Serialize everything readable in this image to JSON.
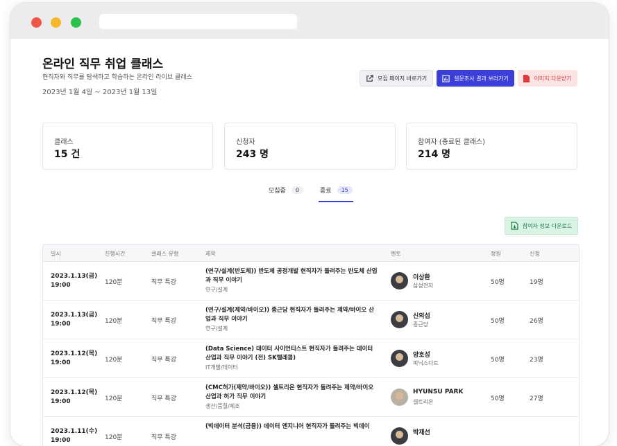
{
  "header": {
    "title": "온라인 직무 취업 클래스",
    "subtitle": "현직자와 직무를 탐색하고 학습하는 온라인 라이브 클래스",
    "dates": "2023년 1월 4일 ~ 2023년 1월 13일"
  },
  "buttons": {
    "recruit": "모집 페이지 바로가기",
    "survey": "설문조사 결과 보러가기",
    "image": "이미지 다운받기",
    "participants": "참여자 정보 다운로드"
  },
  "stats": [
    {
      "label": "클래스",
      "value": "15 건"
    },
    {
      "label": "신청자",
      "value": "243 명"
    },
    {
      "label": "참여자 (종료된 클래스)",
      "value": "214 명"
    }
  ],
  "tabs": [
    {
      "label": "모집중",
      "count": "0"
    },
    {
      "label": "종료",
      "count": "15"
    }
  ],
  "table": {
    "headers": [
      "일시",
      "진행시간",
      "클래스 유형",
      "제목",
      "멘토",
      "정원",
      "신청"
    ],
    "rows": [
      {
        "date": "2023.1.13(금)",
        "time": "19:00",
        "duration": "120분",
        "type": "직무 특강",
        "title": "(연구/설계(반도체)) 반도체 공정개발 현직자가 들려주는 반도체 산업과 직무 이야기",
        "category": "연구/설계",
        "mentor": "이상환",
        "company": "삼성전자",
        "capacity": "50명",
        "applied": "19명"
      },
      {
        "date": "2023.1.13(금)",
        "time": "19:00",
        "duration": "120분",
        "type": "직무 특강",
        "title": "(연구/설계(제약/바이오)) 종근당 현직자가 들려주는 제약/바이오 산업과 직무 이야기",
        "category": "연구/설계",
        "mentor": "신의섭",
        "company": "종근당",
        "capacity": "50명",
        "applied": "26명"
      },
      {
        "date": "2023.1.12(목)",
        "time": "19:00",
        "duration": "120분",
        "type": "직무 특강",
        "title": "(Data Science) 데이터 사이언티스트 현직자가 들려주는 데이터 산업과 직무 이야기 (전) SK텔레콤)",
        "category": "IT개발/데이터",
        "mentor": "양호성",
        "company": "피닉스다트",
        "capacity": "50명",
        "applied": "23명"
      },
      {
        "date": "2023.1.12(목)",
        "time": "19:00",
        "duration": "120분",
        "type": "직무 특강",
        "title": "(CMC허가(제약/바이오)) 셀트리온 현직자가 들려주는 제약/바이오 산업과 허가 직무 이야기",
        "category": "생산/품질/제조",
        "mentor": "HYUNSU PARK",
        "company": "셀트리온",
        "capacity": "50명",
        "applied": "27명"
      },
      {
        "date": "2023.1.11(수)",
        "time": "19:00",
        "duration": "120분",
        "type": "직무 특강",
        "title": "(빅데이터 분석(금융)) 데이터 엔지니어 현직자가 들려주는 빅데이",
        "category": "",
        "mentor": "박재선",
        "company": "",
        "capacity": "",
        "applied": ""
      }
    ]
  }
}
